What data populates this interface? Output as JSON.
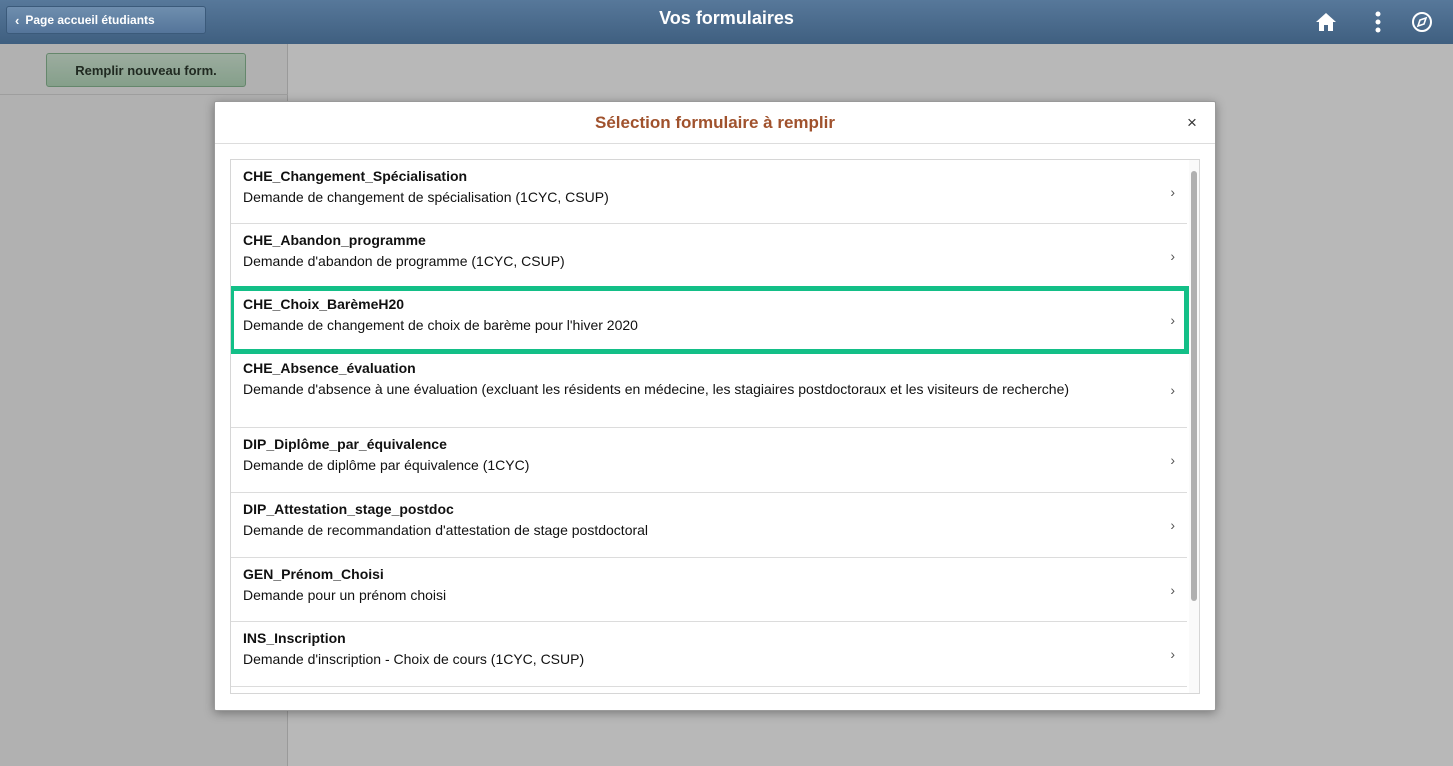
{
  "header": {
    "back_label": "Page accueil étudiants",
    "title": "Vos formulaires",
    "icons": [
      "home-icon",
      "more-vertical-icon",
      "navigator-icon"
    ]
  },
  "left_panel": {
    "new_form_label": "Remplir nouveau form."
  },
  "modal": {
    "title": "Sélection formulaire à remplir",
    "close_label": "×",
    "items": [
      {
        "name": "CHE_Changement_Spécialisation",
        "desc": "Demande de changement de spécialisation (1CYC, CSUP)"
      },
      {
        "name": "CHE_Abandon_programme",
        "desc": "Demande d'abandon de programme  (1CYC, CSUP)"
      },
      {
        "name": "CHE_Choix_BarèmeH20",
        "desc": "Demande de changement de choix de barème pour l'hiver 2020",
        "highlighted": true
      },
      {
        "name": "CHE_Absence_évaluation",
        "desc": "Demande d'absence à une évaluation (excluant les résidents en médecine, les stagiaires postdoctoraux et les visiteurs de recherche)"
      },
      {
        "name": "DIP_Diplôme_par_équivalence",
        "desc": "Demande de diplôme par équivalence (1CYC)"
      },
      {
        "name": "DIP_Attestation_stage_postdoc",
        "desc": "Demande de recommandation d'attestation de stage postdoctoral"
      },
      {
        "name": "GEN_Prénom_Choisi",
        "desc": "Demande pour un prénom choisi"
      },
      {
        "name": "INS_Inscription",
        "desc": "Demande d'inscription - Choix de cours (1CYC, CSUP)"
      }
    ]
  },
  "colors": {
    "header": "#4a6a8a",
    "modal_title": "#a0522d",
    "highlight": "#13bf87",
    "new_form_button": "#c8e6cd"
  }
}
